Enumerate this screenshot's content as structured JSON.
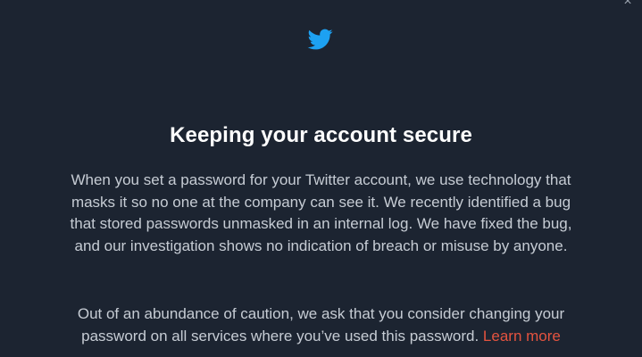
{
  "dialog": {
    "close_label": "×",
    "logo_icon": "twitter-bird-icon",
    "brand_color": "#1da1f2",
    "title": "Keeping your account secure",
    "paragraph1": "When you set a password for your Twitter account, we use technology that masks it so no one at the company can see it. We recently identified a bug that stored passwords unmasked in an internal log. We have fixed the bug, and our investigation shows no indication of breach or misuse by anyone.",
    "paragraph2": "Out of an abundance of caution, we ask that you consider changing your password on all services where you’ve used this password.",
    "learn_more": "Learn more",
    "link_color": "#e4533f"
  }
}
